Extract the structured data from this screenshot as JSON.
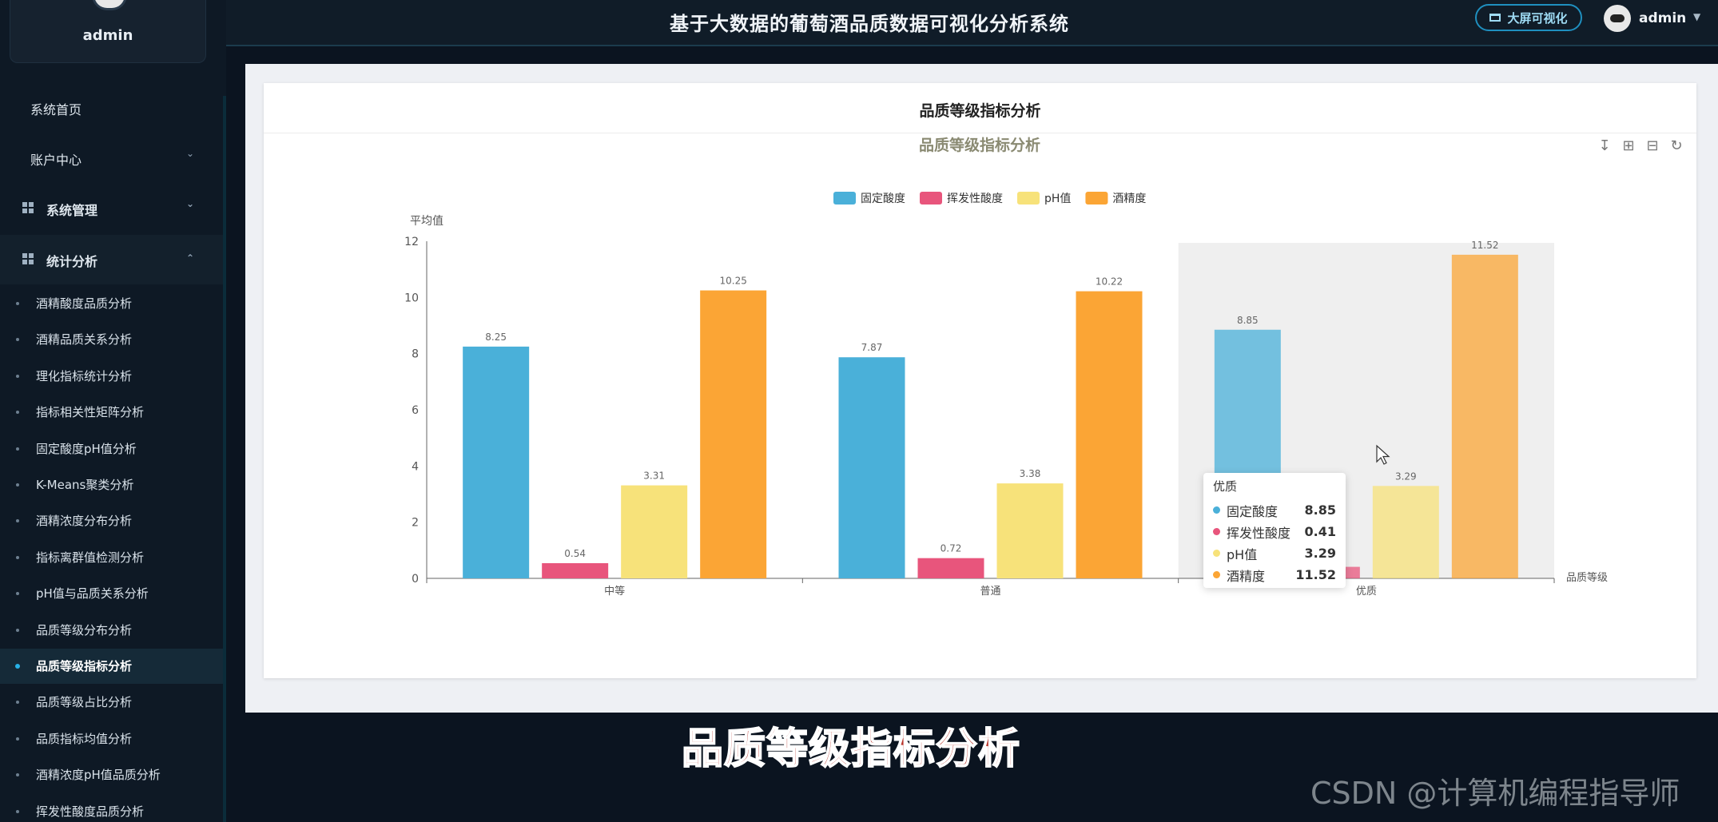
{
  "sidebar": {
    "user_name": "admin",
    "top_items": [
      {
        "label": "系统首页"
      },
      {
        "label": "账户中心"
      }
    ],
    "groups": [
      {
        "label": "系统管理"
      },
      {
        "label": "统计分析"
      }
    ],
    "sub_items": [
      {
        "label": "酒精酸度品质分析"
      },
      {
        "label": "酒精品质关系分析"
      },
      {
        "label": "理化指标统计分析"
      },
      {
        "label": "指标相关性矩阵分析"
      },
      {
        "label": "固定酸度pH值分析"
      },
      {
        "label": "K-Means聚类分析"
      },
      {
        "label": "酒精浓度分布分析"
      },
      {
        "label": "指标离群值检测分析"
      },
      {
        "label": "pH值与品质关系分析"
      },
      {
        "label": "品质等级分布分析"
      },
      {
        "label": "品质等级指标分析"
      },
      {
        "label": "品质等级占比分析"
      },
      {
        "label": "品质指标均值分析"
      },
      {
        "label": "酒精浓度pH值品质分析"
      },
      {
        "label": "挥发性酸度品质分析"
      }
    ],
    "active_index": 10
  },
  "header": {
    "title": "基于大数据的葡萄酒品质数据可视化分析系统",
    "bigscreen_label": "大屏可视化",
    "user_name": "admin"
  },
  "card": {
    "title": "品质等级指标分析"
  },
  "tooltip": {
    "title": "优质",
    "rows": [
      {
        "name": "固定酸度",
        "value": "8.85"
      },
      {
        "name": "挥发性酸度",
        "value": "0.41"
      },
      {
        "name": "pH值",
        "value": "3.29"
      },
      {
        "name": "酒精度",
        "value": "11.52"
      }
    ]
  },
  "caption": "品质等级指标分析",
  "watermark": "CSDN @计算机编程指导师",
  "colors": {
    "series": [
      "#4ab0d9",
      "#e8557c",
      "#f7e27a",
      "#fba535"
    ]
  },
  "chart_data": {
    "type": "bar",
    "title": "品质等级指标分析",
    "xlabel": "品质等级",
    "ylabel": "平均值",
    "ylim": [
      0,
      12
    ],
    "yticks": [
      "0",
      "2",
      "4",
      "6",
      "8",
      "10",
      "12"
    ],
    "categories": [
      "中等",
      "普通",
      "优质"
    ],
    "legend_position": "top-center",
    "highlight_category": "优质",
    "series": [
      {
        "name": "固定酸度",
        "values": [
          8.25,
          7.87,
          8.85
        ],
        "labels": [
          "8.25",
          "7.87",
          "8.85"
        ]
      },
      {
        "name": "挥发性酸度",
        "values": [
          0.54,
          0.72,
          0.41
        ],
        "labels": [
          "0.54",
          "0.72",
          "0.41"
        ]
      },
      {
        "name": "pH值",
        "values": [
          3.31,
          3.38,
          3.29
        ],
        "labels": [
          "3.31",
          "3.38",
          "3.29"
        ]
      },
      {
        "name": "酒精度",
        "values": [
          10.25,
          10.22,
          11.52
        ],
        "labels": [
          "10.25",
          "10.22",
          "11.52"
        ]
      }
    ]
  }
}
